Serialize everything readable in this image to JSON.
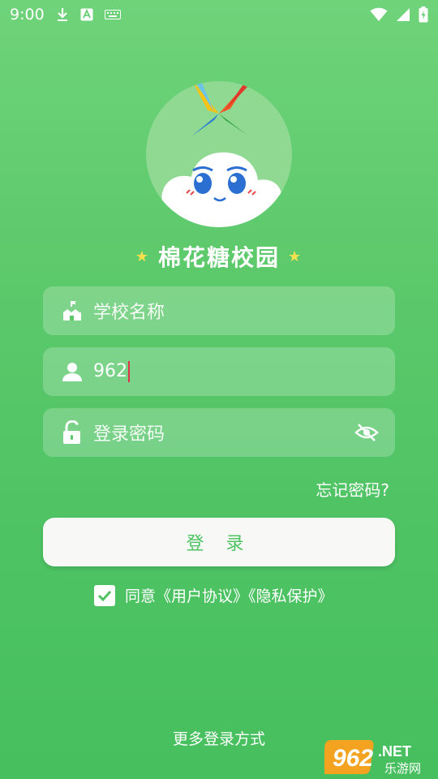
{
  "status_bar": {
    "time": "9:00",
    "left_icons": [
      "download-icon",
      "keyboard-a-icon",
      "keyboard-icon"
    ],
    "right_icons": [
      "wifi-icon",
      "signal-icon",
      "battery-icon"
    ]
  },
  "app": {
    "title": "棉花糖校园",
    "star": "★"
  },
  "form": {
    "school": {
      "placeholder": "学校名称",
      "icon": "school-icon"
    },
    "account": {
      "value": "962",
      "icon": "user-icon"
    },
    "password": {
      "placeholder": "登录密码",
      "icon": "lock-icon",
      "toggle_icon": "eye-off-icon"
    },
    "forgot_label": "忘记密码?",
    "login_label": "登 录",
    "agree": {
      "checked": true,
      "prefix": "同意",
      "agreement": "《用户协议》",
      "privacy": "《隐私保护》"
    }
  },
  "more_login": "更多登录方式",
  "watermark": {
    "brand": "962.NET",
    "site": "乐游网"
  },
  "colors": {
    "primary_green": "#4fc362",
    "background_top": "#6fd37a",
    "background_bottom": "#47bf5e",
    "cursor": "#e0304a",
    "star": "#ffe14d"
  }
}
